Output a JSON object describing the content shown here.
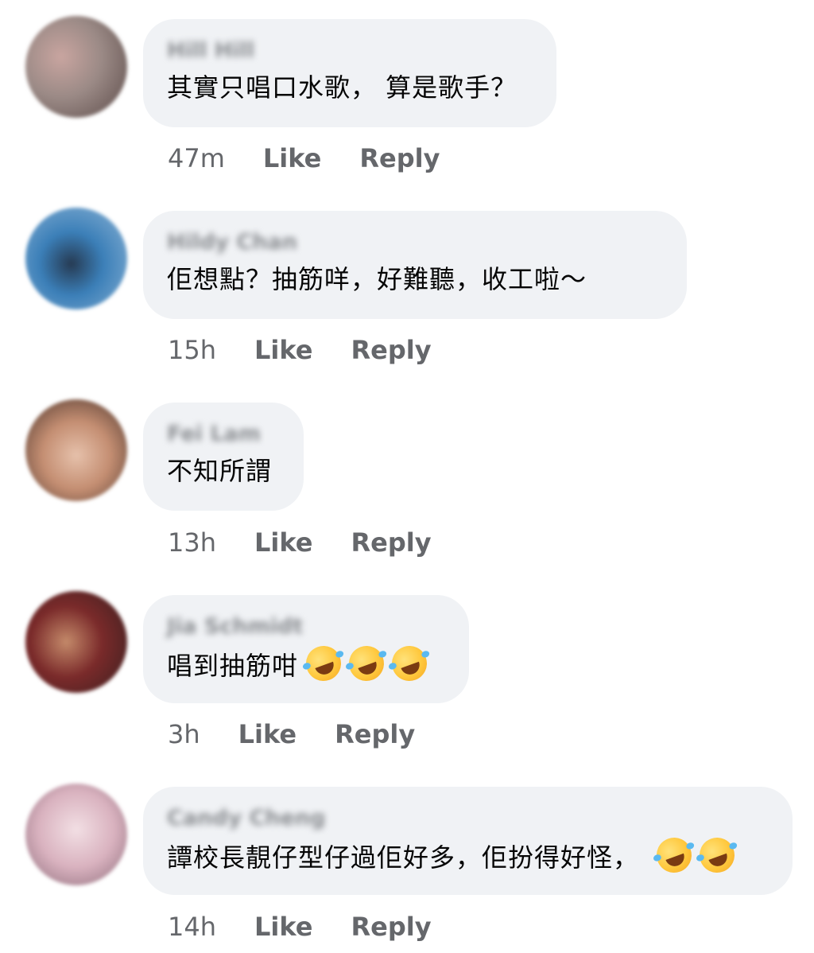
{
  "comments": [
    {
      "name": "Hill Hill",
      "text": "其實只唱口水歌， 算是歌手？",
      "emoji_count": 0,
      "time": "47m",
      "like_label": "Like",
      "reply_label": "Reply",
      "avatar_colors": [
        "#9b8a86",
        "#c9a5a0",
        "#5b4a48"
      ]
    },
    {
      "name": "Hildy Chan",
      "text": "佢想點？抽筋咩，好難聽，收工啦～",
      "emoji_count": 0,
      "time": "15h",
      "like_label": "Like",
      "reply_label": "Reply",
      "avatar_colors": [
        "#3b7fb8",
        "#8fb5d6",
        "#263a52"
      ]
    },
    {
      "name": "Fei Lam",
      "text": "不知所謂",
      "emoji_count": 0,
      "time": "13h",
      "like_label": "Like",
      "reply_label": "Reply",
      "avatar_colors": [
        "#c48e72",
        "#e6c1ab",
        "#4a342c"
      ]
    },
    {
      "name": "Jia Schmidt",
      "text": "唱到抽筋咁",
      "emoji_count": 3,
      "emoji_name": "rolling-on-floor-laughing",
      "time": "3h",
      "like_label": "Like",
      "reply_label": "Reply",
      "avatar_colors": [
        "#7a2a2a",
        "#c48a6a",
        "#3a2020"
      ]
    },
    {
      "name": "Candy Cheng",
      "text": "譚校長靚仔型仔過佢好多，佢扮得好怪，",
      "emoji_count": 2,
      "emoji_name": "rolling-on-floor-laughing",
      "time": "14h",
      "like_label": "Like",
      "reply_label": "Reply",
      "avatar_colors": [
        "#d9b2bf",
        "#f2dfe4",
        "#8a6a78"
      ]
    }
  ]
}
